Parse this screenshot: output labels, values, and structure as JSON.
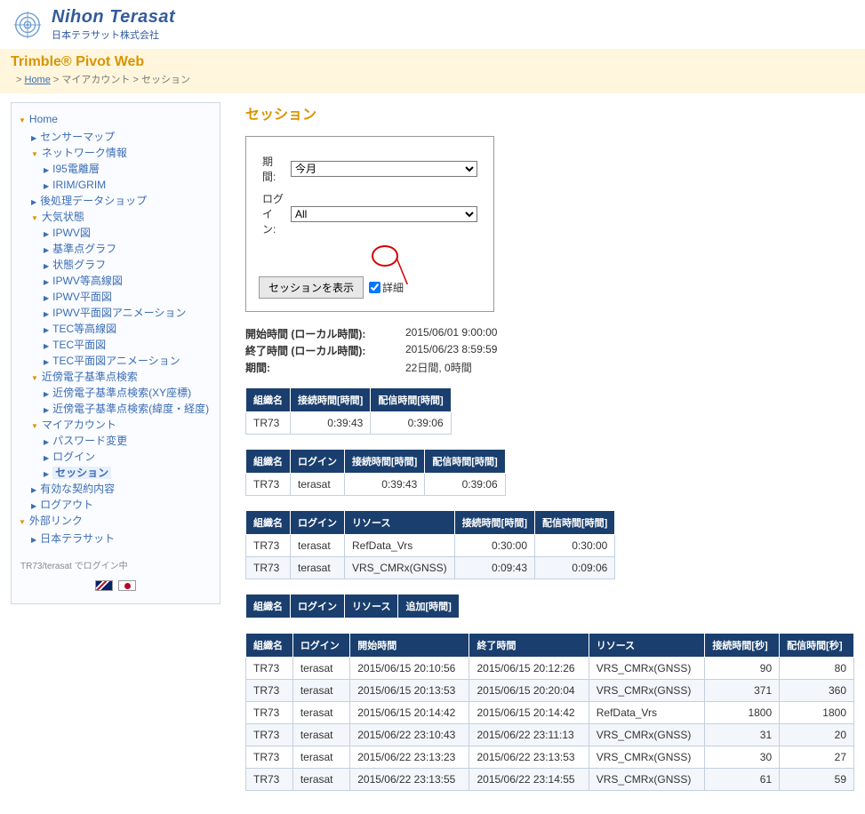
{
  "header": {
    "logo_main": "Nihon Terasat",
    "logo_sub": "日本テラサット株式会社",
    "app_title": "Trimble® Pivot Web"
  },
  "breadcrumb": {
    "home": "Home",
    "sep": ">",
    "myaccount": "マイアカウント",
    "current": "セッション"
  },
  "sidebar": {
    "items": [
      {
        "label": "Home",
        "open": true,
        "children": [
          {
            "label": "センサーマップ"
          },
          {
            "label": "ネットワーク情報",
            "open": true,
            "children": [
              {
                "label": "I95電離層"
              },
              {
                "label": "IRIM/GRIM"
              }
            ]
          },
          {
            "label": "後処理データショップ"
          },
          {
            "label": "大気状態",
            "open": true,
            "children": [
              {
                "label": "IPWV図"
              },
              {
                "label": "基準点グラフ"
              },
              {
                "label": "状態グラフ"
              },
              {
                "label": "IPWV等高線図"
              },
              {
                "label": "IPWV平面図"
              },
              {
                "label": "IPWV平面図アニメーション"
              },
              {
                "label": "TEC等高線図"
              },
              {
                "label": "TEC平面図"
              },
              {
                "label": "TEC平面図アニメーション"
              }
            ]
          },
          {
            "label": "近傍電子基準点検索",
            "open": true,
            "children": [
              {
                "label": "近傍電子基準点検索(XY座標)"
              },
              {
                "label": "近傍電子基準点検索(緯度・経度)"
              }
            ]
          },
          {
            "label": "マイアカウント",
            "open": true,
            "children": [
              {
                "label": "パスワード変更"
              },
              {
                "label": "ログイン"
              },
              {
                "label": "セッション",
                "current": true
              }
            ]
          },
          {
            "label": "有効な契約内容"
          },
          {
            "label": "ログアウト"
          }
        ]
      },
      {
        "label": "外部リンク",
        "open": true,
        "children": [
          {
            "label": "日本テラサット"
          }
        ]
      }
    ],
    "login_status": "TR73/terasat でログイン中"
  },
  "content": {
    "page_title": "セッション",
    "filter": {
      "period_label": "期間:",
      "period_value": "今月",
      "login_label": "ログイン:",
      "login_value": "All",
      "show_button": "セッションを表示",
      "detail_label": "詳細",
      "detail_checked": true
    },
    "info": {
      "start_label": "開始時間 (ローカル時間):",
      "start_value": "2015/06/01 9:00:00",
      "end_label": "終了時間 (ローカル時間):",
      "end_value": "2015/06/23 8:59:59",
      "duration_label": "期間:",
      "duration_value": "22日間, 0時間"
    },
    "table1": {
      "headers": [
        "組織名",
        "接続時間[時間]",
        "配信時間[時間]"
      ],
      "rows": [
        [
          "TR73",
          "0:39:43",
          "0:39:06"
        ]
      ]
    },
    "table2": {
      "headers": [
        "組織名",
        "ログイン",
        "接続時間[時間]",
        "配信時間[時間]"
      ],
      "rows": [
        [
          "TR73",
          "terasat",
          "0:39:43",
          "0:39:06"
        ]
      ]
    },
    "table3": {
      "headers": [
        "組織名",
        "ログイン",
        "リソース",
        "接続時間[時間]",
        "配信時間[時間]"
      ],
      "rows": [
        [
          "TR73",
          "terasat",
          "RefData_Vrs",
          "0:30:00",
          "0:30:00"
        ],
        [
          "TR73",
          "terasat",
          "VRS_CMRx(GNSS)",
          "0:09:43",
          "0:09:06"
        ]
      ]
    },
    "table4": {
      "headers": [
        "組織名",
        "ログイン",
        "リソース",
        "追加[時間]"
      ]
    },
    "table5": {
      "headers": [
        "組織名",
        "ログイン",
        "開始時間",
        "終了時間",
        "リソース",
        "接続時間[秒]",
        "配信時間[秒]"
      ],
      "rows": [
        [
          "TR73",
          "terasat",
          "2015/06/15 20:10:56",
          "2015/06/15 20:12:26",
          "VRS_CMRx(GNSS)",
          "90",
          "80"
        ],
        [
          "TR73",
          "terasat",
          "2015/06/15 20:13:53",
          "2015/06/15 20:20:04",
          "VRS_CMRx(GNSS)",
          "371",
          "360"
        ],
        [
          "TR73",
          "terasat",
          "2015/06/15 20:14:42",
          "2015/06/15 20:14:42",
          "RefData_Vrs",
          "1800",
          "1800"
        ],
        [
          "TR73",
          "terasat",
          "2015/06/22 23:10:43",
          "2015/06/22 23:11:13",
          "VRS_CMRx(GNSS)",
          "31",
          "20"
        ],
        [
          "TR73",
          "terasat",
          "2015/06/22 23:13:23",
          "2015/06/22 23:13:53",
          "VRS_CMRx(GNSS)",
          "30",
          "27"
        ],
        [
          "TR73",
          "terasat",
          "2015/06/22 23:13:55",
          "2015/06/22 23:14:55",
          "VRS_CMRx(GNSS)",
          "61",
          "59"
        ]
      ]
    }
  }
}
